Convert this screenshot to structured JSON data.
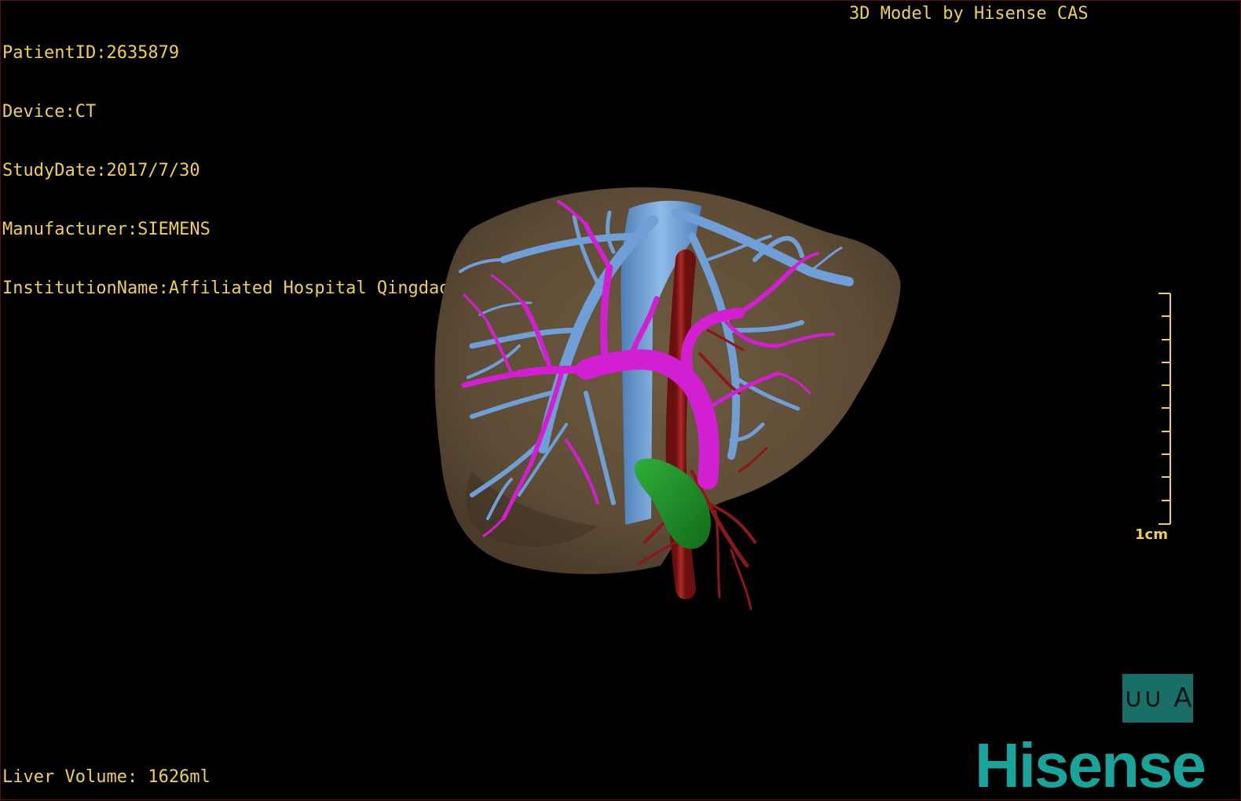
{
  "header": {
    "lines": [
      "PatientID:2635879",
      "Device:CT",
      "StudyDate:2017/7/30",
      "Manufacturer:SIEMENS",
      "InstitutionName:Affiliated Hospital Qingdao University-C"
    ],
    "credit": "3D Model by Hisense CAS"
  },
  "footer": {
    "liver_volume": "Liver Volume: 1626ml"
  },
  "scale": {
    "label": "1cm"
  },
  "orientation": {
    "left_glyph": "∪∪",
    "right_glyph": "A"
  },
  "brand": {
    "logo": "Hisense"
  },
  "colors": {
    "overlay_text": "#f0d050",
    "liver": "#5e4c36",
    "hepatic_vein": "#6f9fd6",
    "portal_vein": "#d21fd2",
    "artery": "#8a1818",
    "gallbladder": "#1f8a28",
    "brand": "#1aa39a"
  }
}
